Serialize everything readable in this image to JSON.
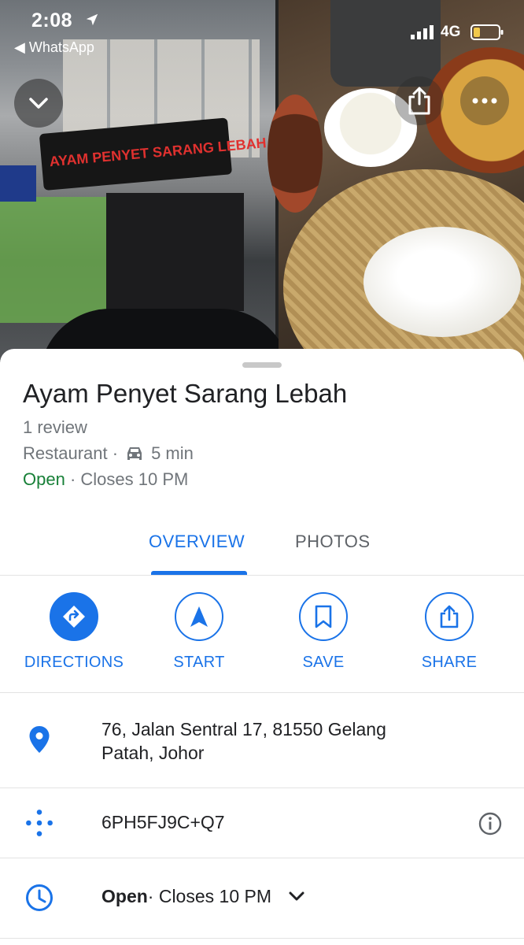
{
  "status_bar": {
    "time": "2:08",
    "back_app": "◀ WhatsApp",
    "network": "4G"
  },
  "photos": {
    "shop_sign_text": "AYAM PENYET SARANG LEBAH"
  },
  "place": {
    "name": "Ayam Penyet Sarang Lebah",
    "reviews": "1 review",
    "category": "Restaurant ·",
    "drive_time": "5 min",
    "open_status": "Open",
    "closes": " · Closes 10 PM"
  },
  "tabs": [
    {
      "label": "OVERVIEW",
      "active": true
    },
    {
      "label": "PHOTOS",
      "active": false
    }
  ],
  "actions": {
    "directions": "DIRECTIONS",
    "start": "START",
    "save": "SAVE",
    "share": "SHARE"
  },
  "details": {
    "address": "76, Jalan Sentral 17, 81550 Gelang Patah, Johor",
    "plus_code": "6PH5FJ9C+Q7",
    "hours_open": "Open",
    "hours_closes": " · Closes 10 PM"
  },
  "colors": {
    "accent": "#1a73e8",
    "open_green": "#188038",
    "secondary_text": "#70757a"
  },
  "icons": [
    "location-arrow-icon",
    "signal-icon",
    "battery-icon",
    "chevron-down-icon",
    "share-icon",
    "more-icon",
    "car-icon",
    "directions-icon",
    "navigation-icon",
    "bookmark-icon",
    "map-pin-icon",
    "plus-code-icon",
    "info-icon",
    "clock-icon"
  ]
}
